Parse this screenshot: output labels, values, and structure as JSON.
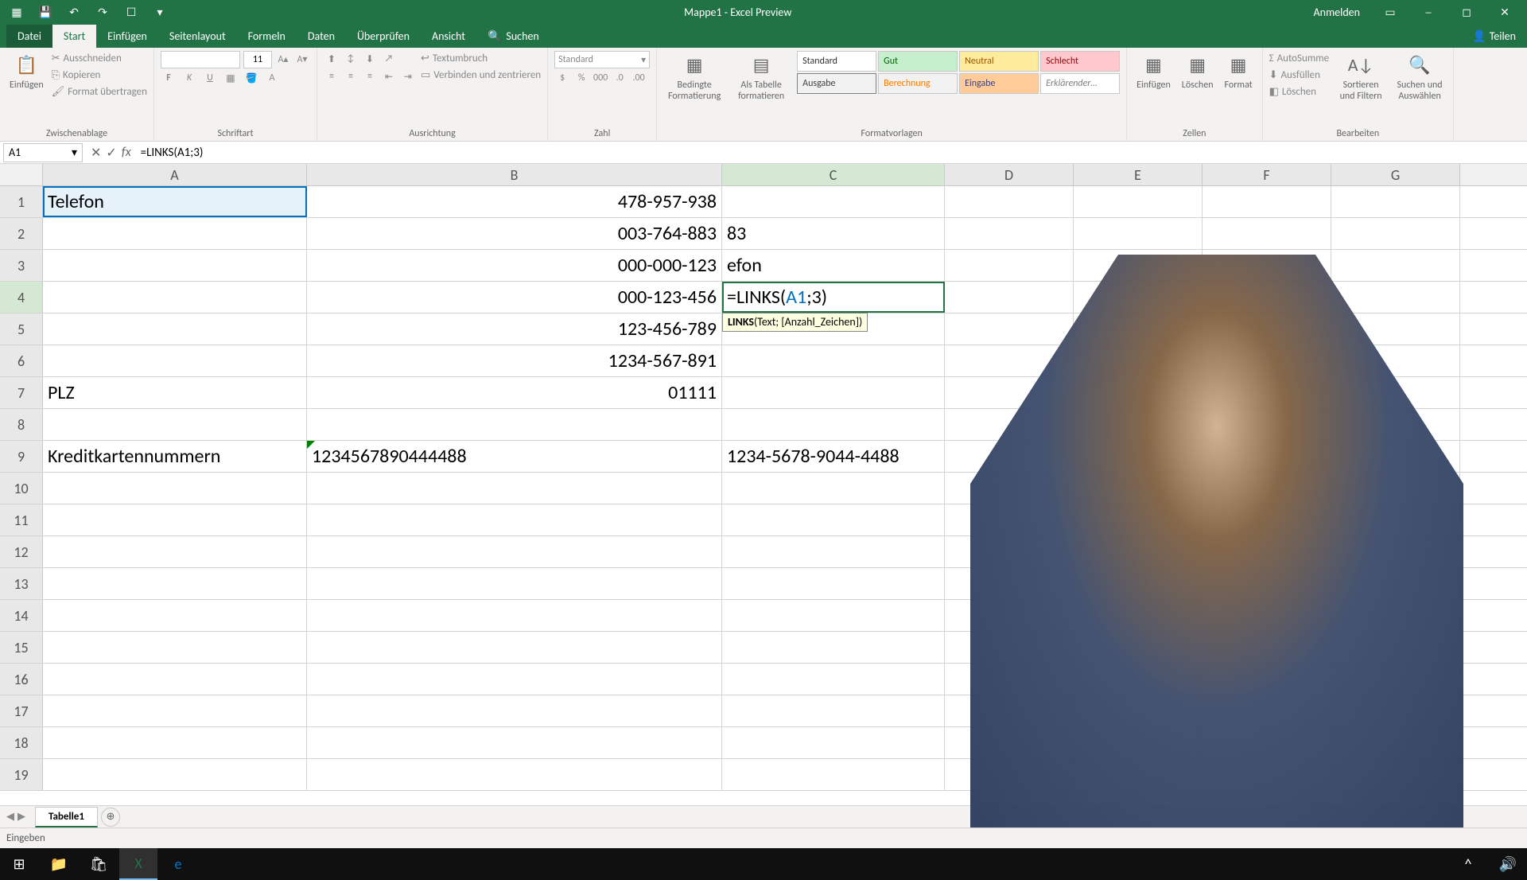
{
  "titlebar": {
    "title": "Mappe1 - Excel Preview",
    "signin": "Anmelden"
  },
  "tabs": {
    "file": "Datei",
    "start": "Start",
    "insert": "Einfügen",
    "layout": "Seitenlayout",
    "formulas": "Formeln",
    "data": "Daten",
    "review": "Überprüfen",
    "view": "Ansicht",
    "search": "Suchen",
    "share": "Teilen"
  },
  "ribbon": {
    "clipboard": {
      "paste": "Einfügen",
      "cut": "Ausschneiden",
      "copy": "Kopieren",
      "painter": "Format übertragen",
      "label": "Zwischenablage"
    },
    "font": {
      "size": "11",
      "label": "Schriftart"
    },
    "align": {
      "wrap": "Textumbruch",
      "merge": "Verbinden und zentrieren",
      "label": "Ausrichtung"
    },
    "number": {
      "format": "Standard",
      "label": "Zahl"
    },
    "styles": {
      "cond": "Bedingte Formatierung",
      "table": "Als Tabelle formatieren",
      "std": "Standard",
      "gut": "Gut",
      "neutral": "Neutral",
      "schlecht": "Schlecht",
      "ausgabe": "Ausgabe",
      "berechnung": "Berechnung",
      "eingabe": "Eingabe",
      "erkl": "Erklärender…",
      "label": "Formatvorlagen"
    },
    "cells": {
      "insert": "Einfügen",
      "delete": "Löschen",
      "format": "Format",
      "label": "Zellen"
    },
    "editing": {
      "autosum": "AutoSumme",
      "fill": "Ausfüllen",
      "clear": "Löschen",
      "sort": "Sortieren und Filtern",
      "find": "Suchen und Auswählen",
      "label": "Bearbeiten"
    }
  },
  "namebox": "A1",
  "formula": "=LINKS(A1;3)",
  "columns": [
    "A",
    "B",
    "C",
    "D",
    "E",
    "F",
    "G"
  ],
  "rows": [
    "1",
    "2",
    "3",
    "4",
    "5",
    "6",
    "7",
    "8",
    "9",
    "10",
    "11",
    "12",
    "13",
    "14",
    "15",
    "16",
    "17",
    "18",
    "19"
  ],
  "cells": {
    "a1": "Telefon",
    "b1": "478-957-938",
    "b2": "003-764-883",
    "c2": "83",
    "b3": "000-000-123",
    "c3": "efon",
    "b4": "000-123-456",
    "c4_formula_prefix": "=LINKS(",
    "c4_formula_ref": "A1",
    "c4_formula_suffix": ";3)",
    "b5": "123-456-789",
    "b6": "1234-567-891",
    "a7": "PLZ",
    "b7": "01111",
    "a9": "Kreditkartennummern",
    "b9": "1234567890444488",
    "c9": "1234-5678-9044-4488"
  },
  "tooltip": {
    "fn": "LINKS",
    "args": "(Text; [Anzahl_Zeichen])"
  },
  "sheet": {
    "name": "Tabelle1"
  },
  "status": "Eingeben"
}
